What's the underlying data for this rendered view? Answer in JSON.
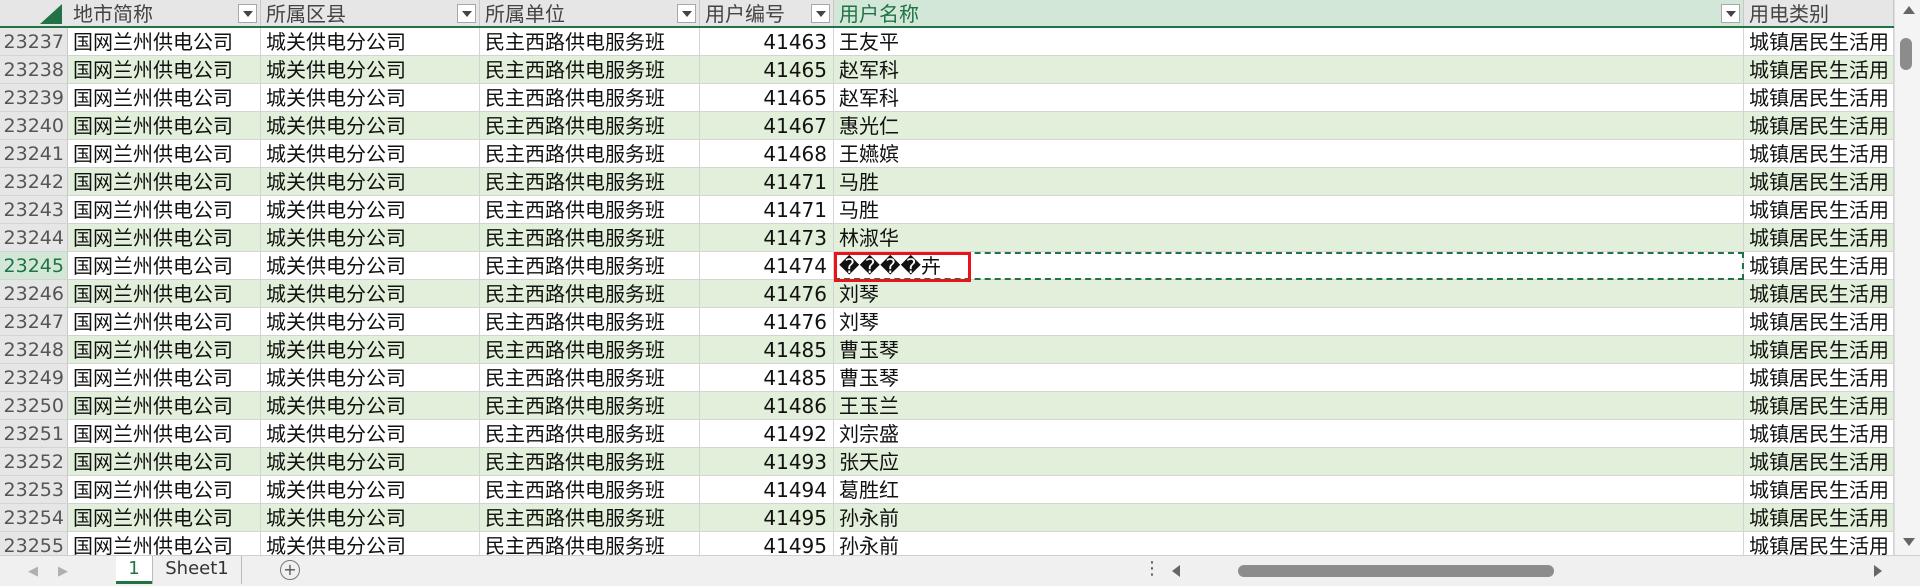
{
  "columns": [
    {
      "label": "地市简称"
    },
    {
      "label": "所属区县"
    },
    {
      "label": "所属单位"
    },
    {
      "label": "用户编号"
    },
    {
      "label": "用户名称"
    },
    {
      "label": "用电类别"
    }
  ],
  "active_row": "23245",
  "active_column": "用户名称",
  "rows": [
    {
      "num": "23237",
      "cells": [
        "国网兰州供电公司",
        "城关供电分公司",
        "民主西路供电服务班",
        "41463",
        "王友平",
        "城镇居民生活用"
      ]
    },
    {
      "num": "23238",
      "cells": [
        "国网兰州供电公司",
        "城关供电分公司",
        "民主西路供电服务班",
        "41465",
        "赵军科",
        "城镇居民生活用"
      ]
    },
    {
      "num": "23239",
      "cells": [
        "国网兰州供电公司",
        "城关供电分公司",
        "民主西路供电服务班",
        "41465",
        "赵军科",
        "城镇居民生活用"
      ]
    },
    {
      "num": "23240",
      "cells": [
        "国网兰州供电公司",
        "城关供电分公司",
        "民主西路供电服务班",
        "41467",
        "惠光仁",
        "城镇居民生活用"
      ]
    },
    {
      "num": "23241",
      "cells": [
        "国网兰州供电公司",
        "城关供电分公司",
        "民主西路供电服务班",
        "41468",
        "王嬿嫔",
        "城镇居民生活用"
      ]
    },
    {
      "num": "23242",
      "cells": [
        "国网兰州供电公司",
        "城关供电分公司",
        "民主西路供电服务班",
        "41471",
        "马胜",
        "城镇居民生活用"
      ]
    },
    {
      "num": "23243",
      "cells": [
        "国网兰州供电公司",
        "城关供电分公司",
        "民主西路供电服务班",
        "41471",
        "马胜",
        "城镇居民生活用"
      ]
    },
    {
      "num": "23244",
      "cells": [
        "国网兰州供电公司",
        "城关供电分公司",
        "民主西路供电服务班",
        "41473",
        "林淑华",
        "城镇居民生活用"
      ]
    },
    {
      "num": "23245",
      "cells": [
        "国网兰州供电公司",
        "城关供电分公司",
        "民主西路供电服务班",
        "41474",
        "����卉",
        "城镇居民生活用"
      ]
    },
    {
      "num": "23246",
      "cells": [
        "国网兰州供电公司",
        "城关供电分公司",
        "民主西路供电服务班",
        "41476",
        "刘琴",
        "城镇居民生活用"
      ]
    },
    {
      "num": "23247",
      "cells": [
        "国网兰州供电公司",
        "城关供电分公司",
        "民主西路供电服务班",
        "41476",
        "刘琴",
        "城镇居民生活用"
      ]
    },
    {
      "num": "23248",
      "cells": [
        "国网兰州供电公司",
        "城关供电分公司",
        "民主西路供电服务班",
        "41485",
        "曹玉琴",
        "城镇居民生活用"
      ]
    },
    {
      "num": "23249",
      "cells": [
        "国网兰州供电公司",
        "城关供电分公司",
        "民主西路供电服务班",
        "41485",
        "曹玉琴",
        "城镇居民生活用"
      ]
    },
    {
      "num": "23250",
      "cells": [
        "国网兰州供电公司",
        "城关供电分公司",
        "民主西路供电服务班",
        "41486",
        "王玉兰",
        "城镇居民生活用"
      ]
    },
    {
      "num": "23251",
      "cells": [
        "国网兰州供电公司",
        "城关供电分公司",
        "民主西路供电服务班",
        "41492",
        "刘宗盛",
        "城镇居民生活用"
      ]
    },
    {
      "num": "23252",
      "cells": [
        "国网兰州供电公司",
        "城关供电分公司",
        "民主西路供电服务班",
        "41493",
        "张天应",
        "城镇居民生活用"
      ]
    },
    {
      "num": "23253",
      "cells": [
        "国网兰州供电公司",
        "城关供电分公司",
        "民主西路供电服务班",
        "41494",
        "葛胜红",
        "城镇居民生活用"
      ]
    },
    {
      "num": "23254",
      "cells": [
        "国网兰州供电公司",
        "城关供电分公司",
        "民主西路供电服务班",
        "41495",
        "孙永前",
        "城镇居民生活用"
      ]
    },
    {
      "num": "23255",
      "cells": [
        "国网兰州供电公司",
        "城关供电分公司",
        "民主西路供电服务班",
        "41495",
        "孙永前",
        "城镇居民生活用"
      ]
    }
  ],
  "tabs": [
    {
      "label": "1"
    },
    {
      "label": "Sheet1"
    }
  ],
  "colors": {
    "band": "#e2efda",
    "accent": "#217346",
    "highlight": "#e8141a"
  },
  "icons": [
    "select-all-triangle-icon",
    "filter-dropdown-icon",
    "add-sheet-icon",
    "more-options-icon",
    "scroll-left-icon",
    "scroll-right-icon",
    "scroll-up-icon",
    "scroll-down-icon"
  ]
}
